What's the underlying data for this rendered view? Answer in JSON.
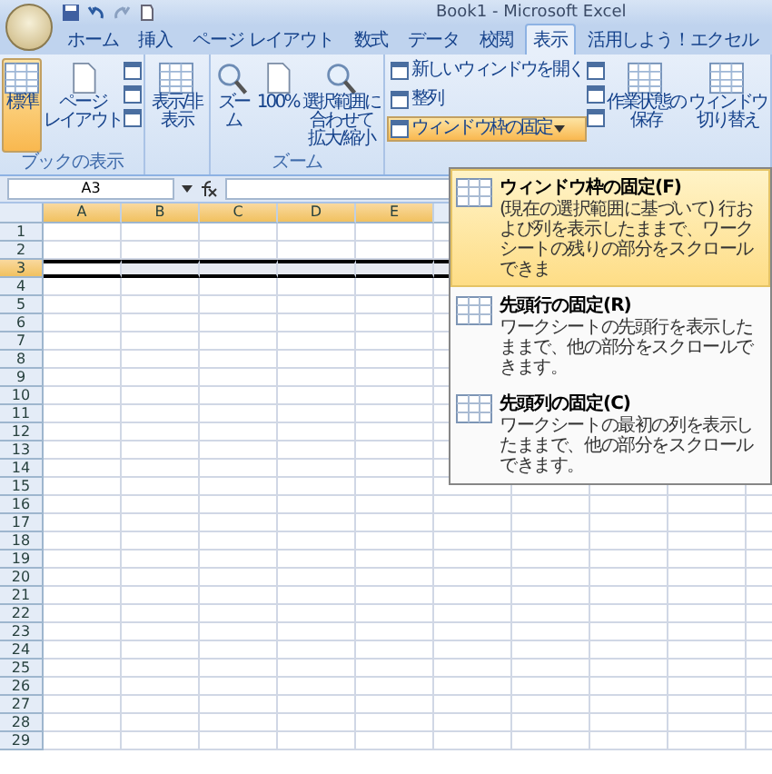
{
  "window": {
    "title": "Book1 - Microsoft Excel"
  },
  "tabs": [
    {
      "label": "ホーム",
      "selected": false
    },
    {
      "label": "挿入",
      "selected": false
    },
    {
      "label": "ページ レイアウト",
      "selected": false
    },
    {
      "label": "数式",
      "selected": false
    },
    {
      "label": "データ",
      "selected": false
    },
    {
      "label": "校閲",
      "selected": false
    },
    {
      "label": "表示",
      "selected": true
    },
    {
      "label": "活用しよう！エクセル",
      "selected": false
    }
  ],
  "ribbon": {
    "groups": [
      {
        "label": "ブックの表示",
        "items": [
          {
            "kind": "large",
            "lines": [
              "標準"
            ],
            "selected": true
          },
          {
            "kind": "large",
            "lines": [
              "ページ",
              "レイアウト"
            ],
            "selected": false
          },
          {
            "kind": "icons"
          }
        ]
      },
      {
        "items": [
          {
            "kind": "large",
            "lines": [
              "表示/非表示"
            ],
            "selected": false
          }
        ]
      },
      {
        "label": "ズーム",
        "items": [
          {
            "kind": "large",
            "lines": [
              "ズーム"
            ],
            "selected": false
          },
          {
            "kind": "large",
            "lines": [
              "100%"
            ],
            "selected": false
          },
          {
            "kind": "large",
            "lines": [
              "選択範囲に",
              "合わせて",
              "拡大/縮小"
            ],
            "selected": false
          }
        ]
      },
      {
        "items": [
          {
            "kind": "stack",
            "items": [
              {
                "label": "新しいウィンドウを開く",
                "expanded": false
              },
              {
                "label": "整列",
                "expanded": false
              },
              {
                "label": "ウィンドウ枠の固定",
                "expanded": true
              }
            ]
          },
          {
            "kind": "icons"
          },
          {
            "kind": "large",
            "lines": [
              "作業状態の",
              "保存"
            ],
            "selected": false
          },
          {
            "kind": "large",
            "lines": [
              "ウィンドウ",
              "切り替え"
            ],
            "selected": false
          }
        ]
      }
    ]
  },
  "formula_bar": {
    "name_box": "A3"
  },
  "sheet": {
    "columns": [
      {
        "label": "A",
        "selected": true
      },
      {
        "label": "B",
        "selected": true
      },
      {
        "label": "C",
        "selected": true
      },
      {
        "label": "D",
        "selected": true
      },
      {
        "label": "E",
        "selected": true
      }
    ],
    "rows": [
      {
        "label": "1",
        "selected": false
      },
      {
        "label": "2",
        "selected": false
      },
      {
        "label": "3",
        "selected": true
      },
      {
        "label": "4",
        "selected": false
      },
      {
        "label": "5",
        "selected": false
      },
      {
        "label": "6",
        "selected": false
      },
      {
        "label": "7",
        "selected": false
      },
      {
        "label": "8",
        "selected": false
      },
      {
        "label": "9",
        "selected": false
      },
      {
        "label": "10",
        "selected": false
      },
      {
        "label": "11",
        "selected": false
      },
      {
        "label": "12",
        "selected": false
      },
      {
        "label": "13",
        "selected": false
      },
      {
        "label": "14",
        "selected": false
      },
      {
        "label": "15",
        "selected": false
      },
      {
        "label": "16",
        "selected": false
      },
      {
        "label": "17",
        "selected": false
      },
      {
        "label": "18",
        "selected": false
      },
      {
        "label": "19",
        "selected": false
      },
      {
        "label": "20",
        "selected": false
      },
      {
        "label": "21",
        "selected": false
      },
      {
        "label": "22",
        "selected": false
      },
      {
        "label": "23",
        "selected": false
      },
      {
        "label": "24",
        "selected": false
      },
      {
        "label": "25",
        "selected": false
      },
      {
        "label": "26",
        "selected": false
      },
      {
        "label": "27",
        "selected": false
      },
      {
        "label": "28",
        "selected": false
      },
      {
        "label": "29",
        "selected": false
      }
    ]
  },
  "dropdown_menu": {
    "items": [
      {
        "title": "ウィンドウ枠の固定(F)",
        "description": "(現在の選択範囲に基づいて) 行および列を表示したままで、ワークシートの残りの部分をスクロールできま",
        "selected": true
      },
      {
        "title": "先頭行の固定(R)",
        "description": "ワークシートの先頭行を表示したままで、他の部分をスクロールできます。",
        "selected": false
      },
      {
        "title": "先頭列の固定(C)",
        "description": "ワークシートの最初の列を表示したままで、他の部分をスクロールできます。",
        "selected": false
      }
    ]
  }
}
